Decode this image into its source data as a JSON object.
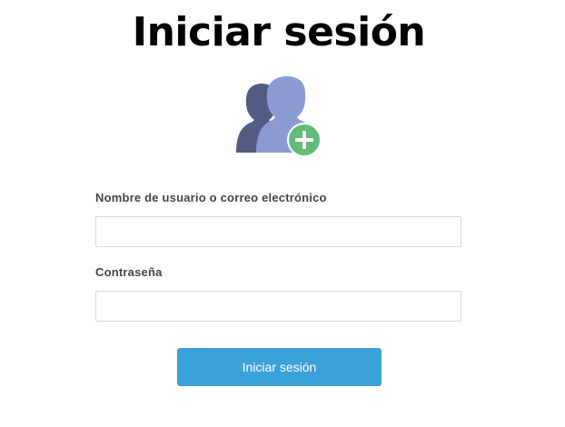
{
  "page": {
    "title": "Iniciar sesión"
  },
  "icons": {
    "header_icon": "users-add-icon"
  },
  "form": {
    "username_label": "Nombre de usuario o correo electrónico",
    "username_value": "",
    "password_label": "Contraseña",
    "password_value": "",
    "submit_label": "Iniciar sesión"
  },
  "colors": {
    "primary_button": "#3aa1da",
    "icon_back_user": "#535c82",
    "icon_front_user": "#8b9bd2",
    "icon_add_badge": "#5fbd78"
  }
}
